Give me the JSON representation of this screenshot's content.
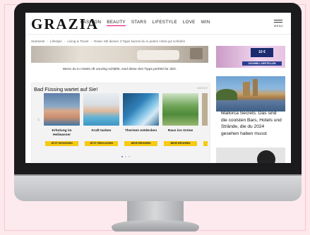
{
  "site": {
    "logo": "GRAZIA",
    "nav": [
      "FASHION",
      "BEAUTY",
      "STARS",
      "LIFESTYLE",
      "LOVE",
      "WIN"
    ],
    "menu_label": "MENU"
  },
  "breadcrumb": [
    "Startseite",
    "Lifestyle",
    "Living & Travel",
    "Reise: Mit diesen 3 Tipps kannst du in jedem Hotel gut schlafen"
  ],
  "article": {
    "caption": "Wenn du in Hotels oft unruhig schläfst, sind diese drei Tipps perfekt für dich."
  },
  "ad": {
    "title": "Bad Füssing wartet auf Sie!",
    "label": "ANZEIGE",
    "cards": [
      {
        "title": "Erholung im Heilwasser",
        "button": "JETZT ENTDECKEN"
      },
      {
        "title": "Kraft tanken",
        "button": "JETZT ERHOLSCHEN"
      },
      {
        "title": "Thermen entdecken",
        "button": "MEHR ERFAHREN"
      },
      {
        "title": "Raus ins Grüne",
        "button": "MEHR ERFAHREN"
      }
    ]
  },
  "sidebar": {
    "ad_badge": "10 €",
    "ad_cta": "1SCHNELL BESTELLEN",
    "article_title": "Mallorca Secrets: Das sind die coolsten Bars, Hotels und Strände, die du 2024 gesehen haben musst"
  },
  "colors": {
    "accent": "#e4007d",
    "button_yellow": "#f6cb12",
    "background": "#fde8ec"
  }
}
